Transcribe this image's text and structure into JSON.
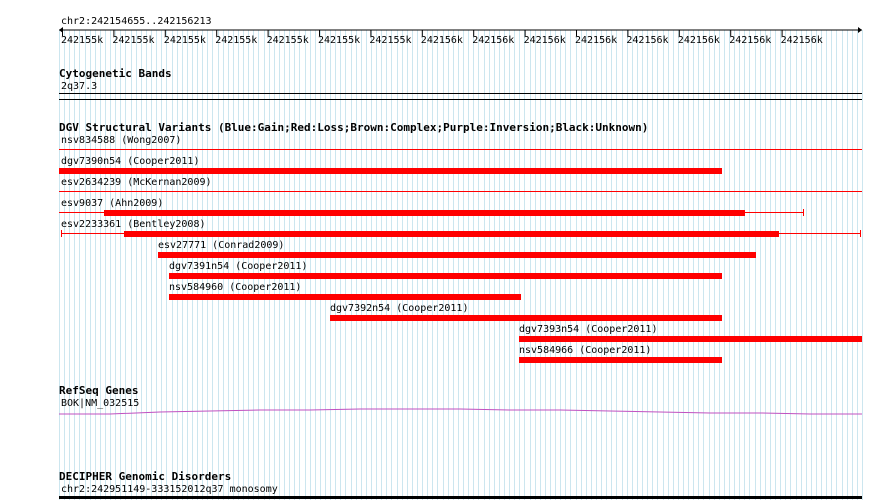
{
  "ruler": {
    "position": "chr2:242154655..242156213",
    "tick_labels": [
      "242155k",
      "242155k",
      "242155k",
      "242155k",
      "242155k",
      "242155k",
      "242155k",
      "242156k",
      "242156k",
      "242156k",
      "242156k",
      "242156k",
      "242156k",
      "242156k",
      "242156k"
    ]
  },
  "tracks": {
    "cytoband": {
      "title": "Cytogenetic Bands",
      "feature": "2q37.3"
    },
    "dgv": {
      "title": "DGV Structural Variants (Blue:Gain;Red:Loss;Brown:Complex;Purple:Inversion;Black:Unknown)",
      "color": "#ff0000",
      "features": [
        {
          "label": "nsv834588 (Wong2007)"
        },
        {
          "label": "dgv7390n54 (Cooper2011)"
        },
        {
          "label": "esv2634239 (McKernan2009)"
        },
        {
          "label": "esv9037 (Ahn2009)"
        },
        {
          "label": "esv2233361 (Bentley2008)"
        },
        {
          "label": "esv27771 (Conrad2009)"
        },
        {
          "label": "dgv7391n54 (Cooper2011)"
        },
        {
          "label": "nsv584960 (Cooper2011)"
        },
        {
          "label": "dgv7392n54 (Cooper2011)"
        },
        {
          "label": "dgv7393n54 (Cooper2011)"
        },
        {
          "label": "nsv584966 (Cooper2011)"
        }
      ]
    },
    "refseq": {
      "title": "RefSeq Genes",
      "feature": "BOK|NM_032515",
      "color": "#c050c0"
    },
    "decipher": {
      "title": "DECIPHER Genomic Disorders",
      "feature": "chr2:242951149-333152012q37 monosomy"
    }
  }
}
